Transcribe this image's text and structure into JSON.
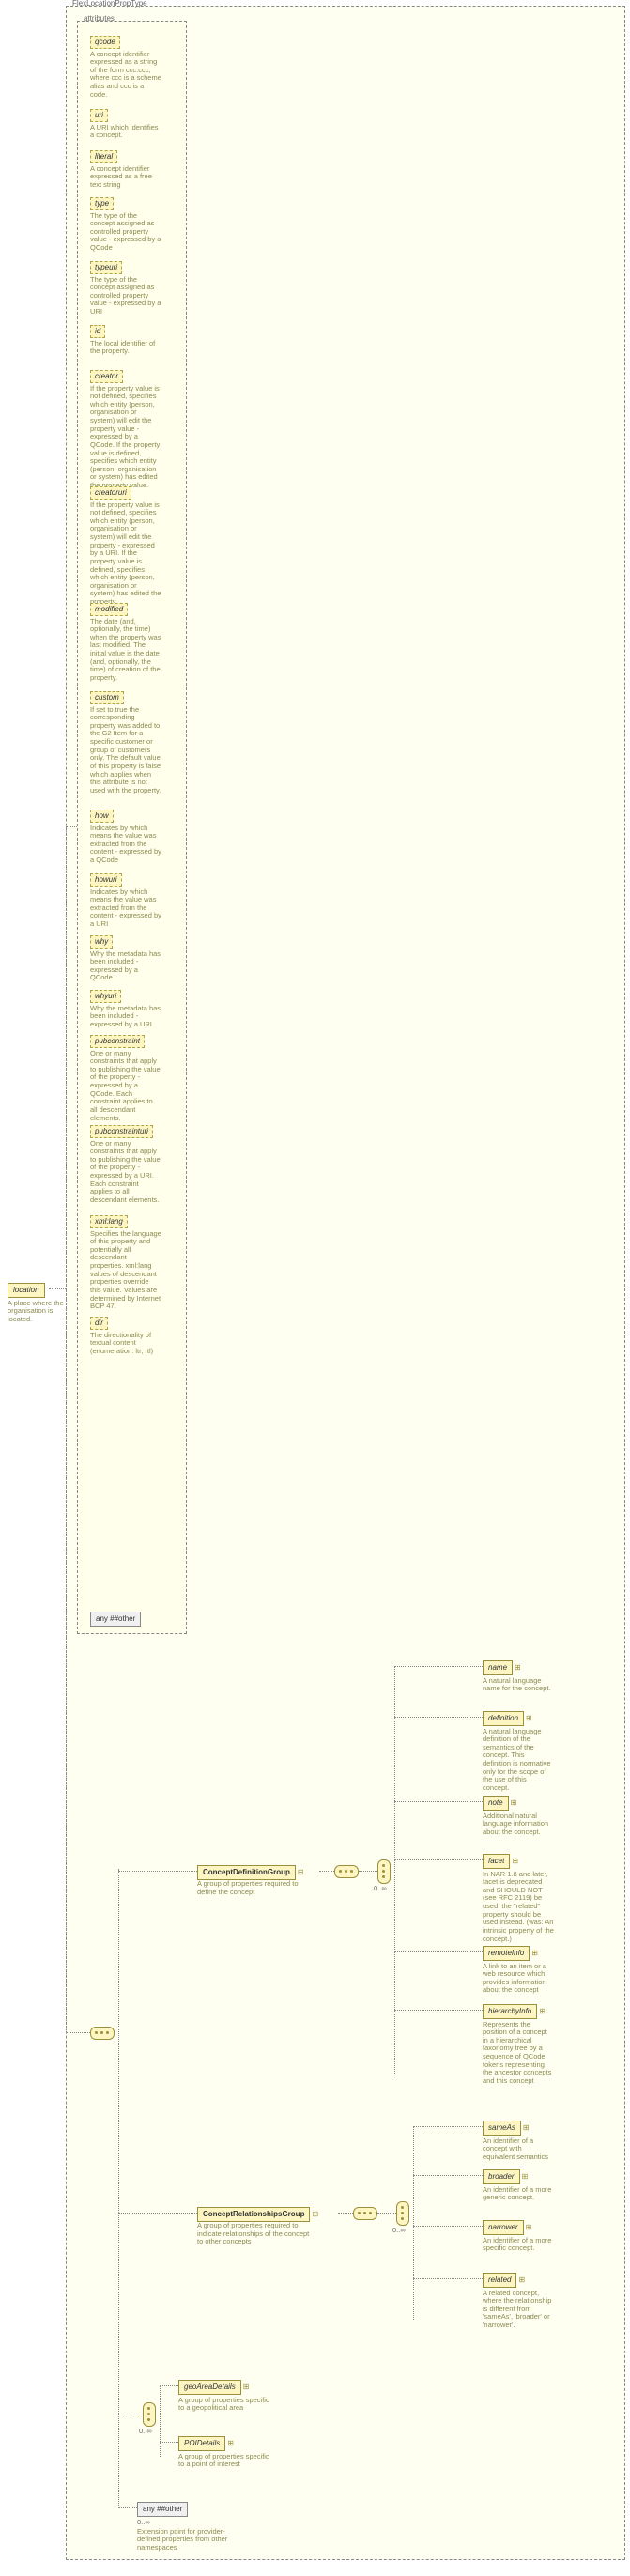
{
  "type_name": "FlexLocationPropType",
  "root": {
    "name": "location",
    "desc": "A place where the organisation is located."
  },
  "attributes_label": "attributes",
  "attributes": [
    {
      "name": "qcode",
      "desc": "A concept identifier expressed as a string of the form ccc:ccc, where ccc is a scheme alias and ccc is a code."
    },
    {
      "name": "uri",
      "desc": "A URI which identifies a concept."
    },
    {
      "name": "literal",
      "desc": "A concept identifier expressed as a free text string"
    },
    {
      "name": "type",
      "desc": "The type of the concept assigned as controlled property value - expressed by a QCode"
    },
    {
      "name": "typeuri",
      "desc": "The type of the concept assigned as controlled property value - expressed by a URI"
    },
    {
      "name": "id",
      "desc": "The local identifier of the property."
    },
    {
      "name": "creator",
      "desc": "If the property value is not defined, specifies which entity (person, organisation or system) will edit the property value - expressed by a QCode. If the property value is defined, specifies which entity (person, organisation or system) has edited the property value."
    },
    {
      "name": "creatoruri",
      "desc": "If the property value is not defined, specifies which entity (person, organisation or system) will edit the property - expressed by a URI. If the property value is defined, specifies which entity (person, organisation or system) has edited the property."
    },
    {
      "name": "modified",
      "desc": "The date (and, optionally, the time) when the property was last modified. The initial value is the date (and, optionally, the time) of creation of the property."
    },
    {
      "name": "custom",
      "desc": "If set to true the corresponding property was added to the G2 Item for a specific customer or group of customers only. The default value of this property is false which applies when this attribute is not used with the property."
    },
    {
      "name": "how",
      "desc": "Indicates by which means the value was extracted from the content - expressed by a QCode"
    },
    {
      "name": "howuri",
      "desc": "Indicates by which means the value was extracted from the content - expressed by a URI"
    },
    {
      "name": "why",
      "desc": "Why the metadata has been included - expressed by a QCode"
    },
    {
      "name": "whyuri",
      "desc": "Why the metadata has been included - expressed by a URI"
    },
    {
      "name": "pubconstraint",
      "desc": "One or many constraints that apply to publishing the value of the property - expressed by a QCode. Each constraint applies to all descendant elements."
    },
    {
      "name": "pubconstrainturi",
      "desc": "One or many constraints that apply to publishing the value of the property - expressed by a URI. Each constraint applies to all descendant elements."
    },
    {
      "name": "xml:lang",
      "desc": "Specifies the language of this property and potentially all descendant properties. xml:lang values of descendant properties override this value. Values are determined by Internet BCP 47."
    },
    {
      "name": "dir",
      "desc": "The directionality of textual content (enumeration: ltr, rtl)"
    }
  ],
  "any_attr_label": "any ##other",
  "groups": {
    "concept_def": {
      "name": "ConceptDefinitionGroup",
      "desc": "A group of properties required to define the concept"
    },
    "concept_rel": {
      "name": "ConceptRelationshipsGroup",
      "desc": "A group of properties required to indicate relationships of the concept to other concepts"
    }
  },
  "def_children": [
    {
      "name": "name",
      "desc": "A natural language name for the concept."
    },
    {
      "name": "definition",
      "desc": "A natural language definition of the semantics of the concept. This definition is normative only for the scope of the use of this concept."
    },
    {
      "name": "note",
      "desc": "Additional natural language information about the concept."
    },
    {
      "name": "facet",
      "desc": "In NAR 1.8 and later, facet is deprecated and SHOULD NOT (see RFC 2119) be used, the \"related\" property should be used instead. (was: An intrinsic property of the concept.)"
    },
    {
      "name": "remoteInfo",
      "desc": "A link to an item or a web resource which provides information about the concept"
    },
    {
      "name": "hierarchyInfo",
      "desc": "Represents the position of a concept in a hierarchical taxonomy tree by a sequence of QCode tokens representing the ancestor concepts and this concept"
    }
  ],
  "rel_children": [
    {
      "name": "sameAs",
      "desc": "An identifier of a concept with equivalent semantics"
    },
    {
      "name": "broader",
      "desc": "An identifier of a more generic concept."
    },
    {
      "name": "narrower",
      "desc": "An identifier of a more specific concept."
    },
    {
      "name": "related",
      "desc": "A related concept, where the relationship is different from 'sameAs', 'broader' or 'narrower'."
    }
  ],
  "detail_children": [
    {
      "name": "geoAreaDetails",
      "desc": "A group of properties specific to a geopolitical area"
    },
    {
      "name": "POIDetails",
      "desc": "A group of properties specific to a point of interest"
    }
  ],
  "any_element": {
    "label": "any ##other",
    "desc": "Extension point for provider-defined properties from other namespaces"
  },
  "occurrence_label": "0..∞"
}
